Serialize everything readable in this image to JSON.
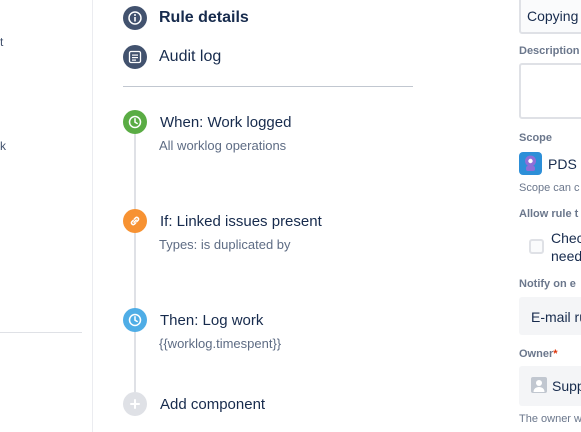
{
  "left_fragments": [
    "t",
    "k"
  ],
  "nav": {
    "rule_details": "Rule details",
    "audit_log": "Audit log"
  },
  "components": [
    {
      "title": "When: Work logged",
      "subtitle": "All worklog operations",
      "color": "#5aac44",
      "icon": "clock-icon"
    },
    {
      "title": "If: Linked issues present",
      "subtitle": "Types: is duplicated by",
      "color": "#f79232",
      "icon": "link-icon"
    },
    {
      "title": "Then: Log work",
      "subtitle": "{{worklog.timespent}}",
      "color": "#4fade6",
      "icon": "clock-icon"
    }
  ],
  "add_component": "Add component",
  "right_panel": {
    "name_value": "Copying",
    "description_label": "Description",
    "scope_label": "Scope",
    "scope_value": "PDS",
    "scope_help": "Scope can c",
    "allow_label": "Allow rule t",
    "checkbox_text_1": "Chec",
    "checkbox_text_2": "need",
    "notify_label": "Notify on e",
    "notify_value": "E-mail ru",
    "owner_label": "Owner",
    "owner_required": "*",
    "owner_value": "Supp",
    "owner_help": "The owner w"
  },
  "colors": {
    "nav_icon": "#42526e",
    "accent": "#0052cc"
  }
}
